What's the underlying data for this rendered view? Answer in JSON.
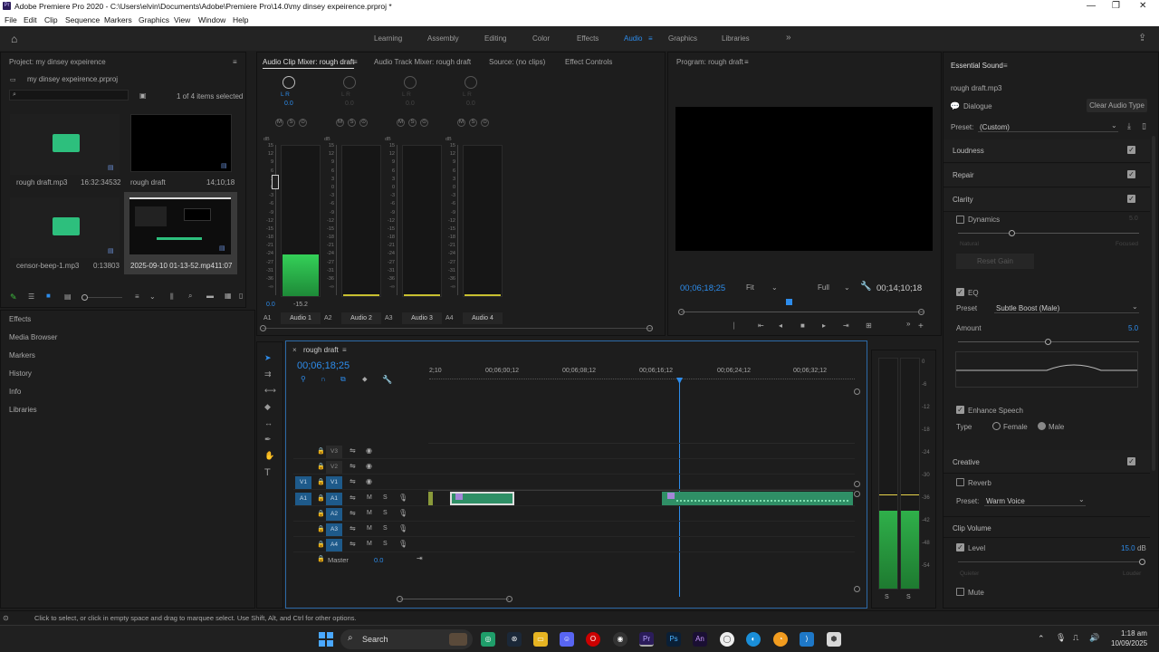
{
  "window": {
    "title": "Adobe Premiere Pro 2020 - C:\\Users\\elvin\\Documents\\Adobe\\Premiere Pro\\14.0\\my dinsey expeirence.prproj *",
    "app_badge": "Pr"
  },
  "menu": [
    "File",
    "Edit",
    "Clip",
    "Sequence",
    "Markers",
    "Graphics",
    "View",
    "Window",
    "Help"
  ],
  "workspaces": [
    "Learning",
    "Assembly",
    "Editing",
    "Color",
    "Effects",
    "Audio",
    "Graphics",
    "Libraries"
  ],
  "active_workspace": "Audio",
  "project": {
    "title": "Project: my dinsey expeirence",
    "file": "my dinsey expeirence.prproj",
    "selection": "1 of 4 items selected",
    "items": [
      {
        "name": "rough draft.mp3",
        "duration": "16:32:34532"
      },
      {
        "name": "rough draft",
        "duration": "14;10;18"
      },
      {
        "name": "censor-beep-1.mp3",
        "duration": "0:13803"
      },
      {
        "name": "2025-09-10 01-13-52.mp4",
        "duration": "11:07"
      }
    ],
    "side_panels": [
      "Effects",
      "Media Browser",
      "Markers",
      "History",
      "Info",
      "Libraries"
    ]
  },
  "mixer": {
    "tabs": [
      "Audio Clip Mixer: rough draft",
      "Audio Track Mixer: rough draft",
      "Source: (no clips)",
      "Effect Controls"
    ],
    "pan_label": "L  R",
    "pan_value": "0.0",
    "msb": [
      "M",
      "S",
      "⊙"
    ],
    "db_label": "dB",
    "db_scale": [
      "15",
      "12",
      "9",
      "6",
      "3",
      "0",
      "-3",
      "-6",
      "-9",
      "-12",
      "-15",
      "-18",
      "-21",
      "-24",
      "-27",
      "-31",
      "-36",
      "-∞"
    ],
    "fader_value": "0.0",
    "peak_value": "-15.2",
    "channels": [
      {
        "id": "A1",
        "name": "Audio 1"
      },
      {
        "id": "A2",
        "name": "Audio 2"
      },
      {
        "id": "A3",
        "name": "Audio 3"
      },
      {
        "id": "A4",
        "name": "Audio 4"
      }
    ]
  },
  "program": {
    "title": "Program: rough draft",
    "timecode": "00;06;18;25",
    "fit": "Fit",
    "quality": "Full",
    "duration": "00;14;10;18"
  },
  "timeline": {
    "tab": "rough draft",
    "timecode": "00;06;18;25",
    "ruler": [
      "2;10",
      "00;06;00;12",
      "00;06;08;12",
      "00;06;16;12",
      "00;06;24;12",
      "00;06;32;12"
    ],
    "video_tracks": [
      "V3",
      "V2",
      "V1"
    ],
    "audio_tracks": [
      "A1",
      "A2",
      "A3",
      "A4"
    ],
    "source_video": "V1",
    "source_audio": "A1",
    "master_label": "Master",
    "master_value": "0.0",
    "ms": [
      "M",
      "S"
    ]
  },
  "level_meter": {
    "scale": [
      "0",
      "-6",
      "-12",
      "-18",
      "-24",
      "-30",
      "-36",
      "-42",
      "-48",
      "-54"
    ],
    "solo": [
      "S",
      "S"
    ]
  },
  "essential_sound": {
    "title": "Essential Sound",
    "clip": "rough draft.mp3",
    "type": "Dialogue",
    "clear_btn": "Clear Audio Type",
    "preset_label": "Preset:",
    "preset_value": "(Custom)",
    "sections": [
      "Loudness",
      "Repair",
      "Clarity"
    ],
    "dynamics": "Dynamics",
    "dyn_value": "5.0",
    "dyn_left": "Natural",
    "dyn_right": "Focused",
    "reset": "Reset Gain",
    "eq": "EQ",
    "eq_preset_label": "Preset",
    "eq_preset": "Subtle Boost (Male)",
    "amount_label": "Amount",
    "amount": "5.0",
    "enhance": "Enhance Speech",
    "type_label": "Type",
    "female": "Female",
    "male": "Male",
    "creative": "Creative",
    "reverb": "Reverb",
    "reverb_preset_label": "Preset:",
    "reverb_preset": "Warm Voice",
    "clip_volume": "Clip Volume",
    "level": "Level",
    "level_value": "15.0",
    "level_unit": "dB",
    "quieter": "Quieter",
    "louder": "Louder",
    "mute": "Mute"
  },
  "status": "Click to select, or click in empty space and drag to marquee select. Use Shift, Alt, and Ctrl for other options.",
  "taskbar": {
    "search": "Search",
    "time": "1:18 am",
    "date": "10/09/2025",
    "apps": [
      "Ps",
      "An",
      "Pr"
    ]
  }
}
